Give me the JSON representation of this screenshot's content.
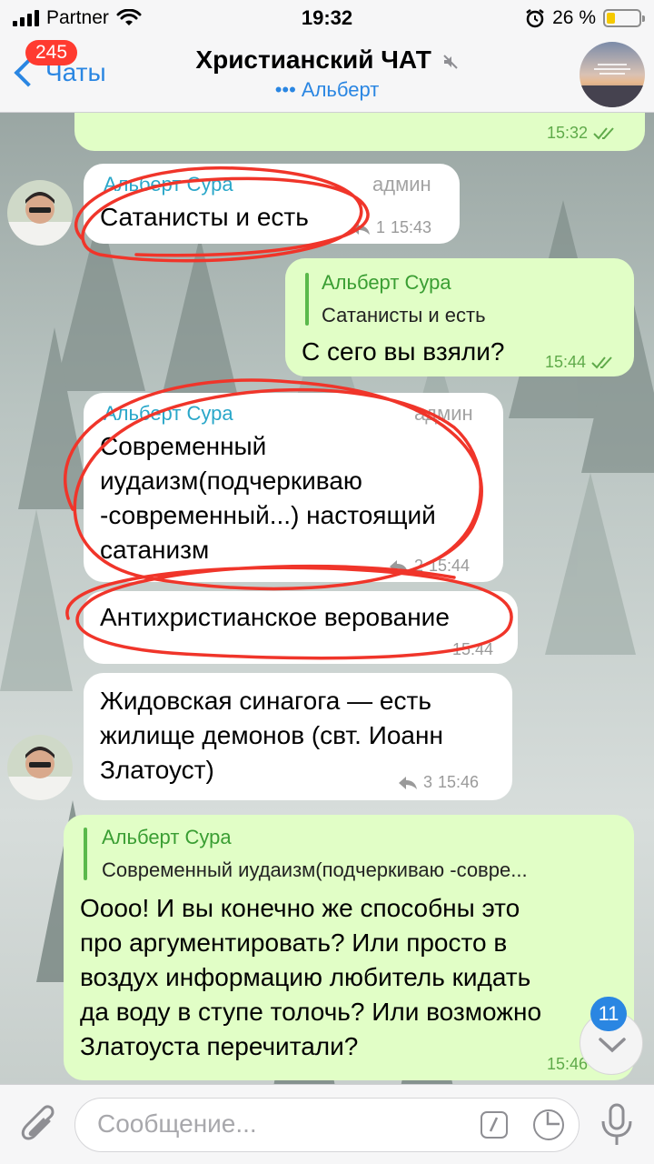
{
  "status_bar": {
    "carrier": "Partner",
    "time": "19:32",
    "battery_percent": "26 %",
    "battery_level": 0.26
  },
  "header": {
    "back_label": "Чаты",
    "unread_count": "245",
    "title": "Христианский ЧАТ",
    "typing_status": "••• Альберт"
  },
  "messages": [
    {
      "type": "outgoing",
      "time": "15:32",
      "status": "read"
    },
    {
      "type": "incoming",
      "sender": "Альберт Сура",
      "role": "админ",
      "text": "Сатанисты и есть",
      "replies": "1",
      "time": "15:43"
    },
    {
      "type": "outgoing",
      "reply_to_name": "Альберт Сура",
      "reply_to_text": "Сатанисты и есть",
      "text": "С сего вы взяли?",
      "time": "15:44",
      "status": "read"
    },
    {
      "type": "incoming",
      "sender": "Альберт Сура",
      "role": "админ",
      "text_lines": [
        "Современный",
        "иудаизм(подчеркиваю",
        "-современный...) настоящий",
        "сатанизм"
      ],
      "replies": "2",
      "time": "15:44"
    },
    {
      "type": "incoming",
      "text": "Антихристианское верование",
      "time": "15:44"
    },
    {
      "type": "incoming",
      "text_lines": [
        "Жидовская синагога — есть",
        "жилище демонов (свт. Иоанн",
        "Златоуст)"
      ],
      "replies": "3",
      "time": "15:46"
    },
    {
      "type": "outgoing",
      "reply_to_name": "Альберт Сура",
      "reply_to_text": "Современный иудаизм(подчеркиваю -совре...",
      "text_lines": [
        "Оооо! И вы конечно же способны это",
        "про аргументировать? Или просто в",
        "воздух информацию любитель кидать",
        "да воду в ступе толочь? Или возможно",
        "Златоуста перечитали?"
      ],
      "time": "15:46"
    }
  ],
  "scroll_down": {
    "badge": "11"
  },
  "composer": {
    "placeholder": "Сообщение..."
  },
  "colors": {
    "accent": "#2a86e2",
    "outgoing_bubble": "#e1fec6",
    "annotation": "#f0352a"
  },
  "icons": [
    "signal-icon",
    "wifi-icon",
    "alarm-icon",
    "battery-icon",
    "back-chevron-icon",
    "mute-icon",
    "reply-arrow-icon",
    "read-checkmarks-icon",
    "attach-paperclip-icon",
    "bot-command-icon",
    "sticker-icon",
    "microphone-icon",
    "chevron-down-icon"
  ]
}
